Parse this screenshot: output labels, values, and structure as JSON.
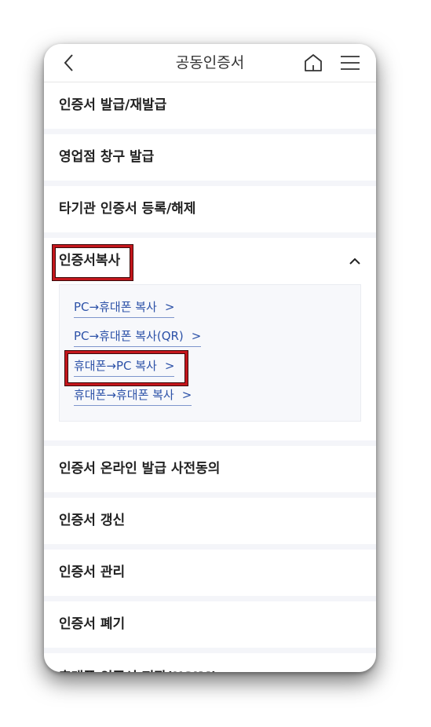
{
  "header": {
    "title": "공동인증서",
    "back_icon": "chevron-left-icon",
    "home_icon": "home-icon",
    "menu_icon": "hamburger-menu-icon"
  },
  "menu": {
    "items": [
      {
        "label": "인증서 발급/재발급"
      },
      {
        "label": "영업점 창구 발급"
      },
      {
        "label": "타기관 인증서 등록/해제"
      }
    ],
    "copy_section": {
      "label": "인증서복사",
      "expanded": true,
      "links": [
        {
          "label": "PC→휴대폰 복사"
        },
        {
          "label": "PC→휴대폰 복사(QR)"
        },
        {
          "label": "휴대폰→PC 복사"
        },
        {
          "label": "휴대폰→휴대폰 복사"
        }
      ],
      "link_arrow": ">"
    },
    "items_after": [
      {
        "label": "인증서 온라인 발급 사전동의"
      },
      {
        "label": "인증서 갱신"
      },
      {
        "label": "인증서 관리"
      },
      {
        "label": "인증서 폐기"
      }
    ],
    "cut_off_item": "휴대폰 인증서 저장(USIM)"
  },
  "colors": {
    "highlight": "#c4161c",
    "link": "#2d52a8",
    "divider": "#f4f5f9"
  }
}
